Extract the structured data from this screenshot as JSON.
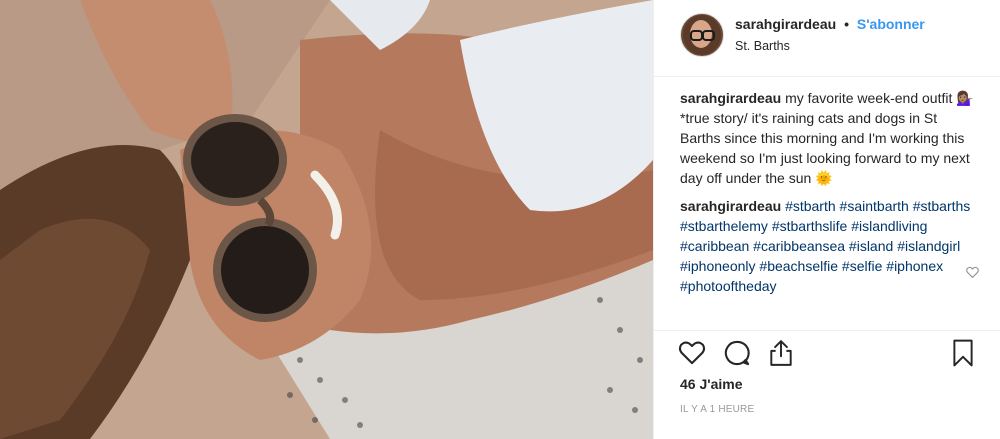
{
  "post": {
    "username": "sarahgirardeau",
    "separator": "•",
    "follow_label": "S'abonner",
    "location": "St. Barths",
    "caption_author": "sarahgirardeau",
    "caption_text": "my favorite week-end outfit 💁🏽‍♀️ *true story/ it's raining cats and dogs in St Barths since this morning and I'm working this weekend so I'm just looking forward to my next day off under the sun 🌞",
    "comment_author": "sarahgirardeau",
    "hashtags": [
      "#stbarth",
      "#saintbarth",
      "#stbarths",
      "#stbarthelemy",
      "#stbarthslife",
      "#islandliving",
      "#caribbean",
      "#caribbeansea",
      "#island",
      "#islandgirl",
      "#iphoneonly",
      "#beachselfie",
      "#selfie",
      "#iphonex",
      "#photooftheday"
    ],
    "likes": "46 J'aime",
    "timestamp": "IL Y A 1 HEURE"
  },
  "icons": {
    "like": "heart-icon",
    "comment": "comment-icon",
    "share": "share-icon",
    "save": "bookmark-icon",
    "comment_like": "small-heart-icon"
  },
  "colors": {
    "link_blue": "#3897f0",
    "hashtag": "#003569",
    "text": "#262626",
    "muted": "#999999"
  }
}
